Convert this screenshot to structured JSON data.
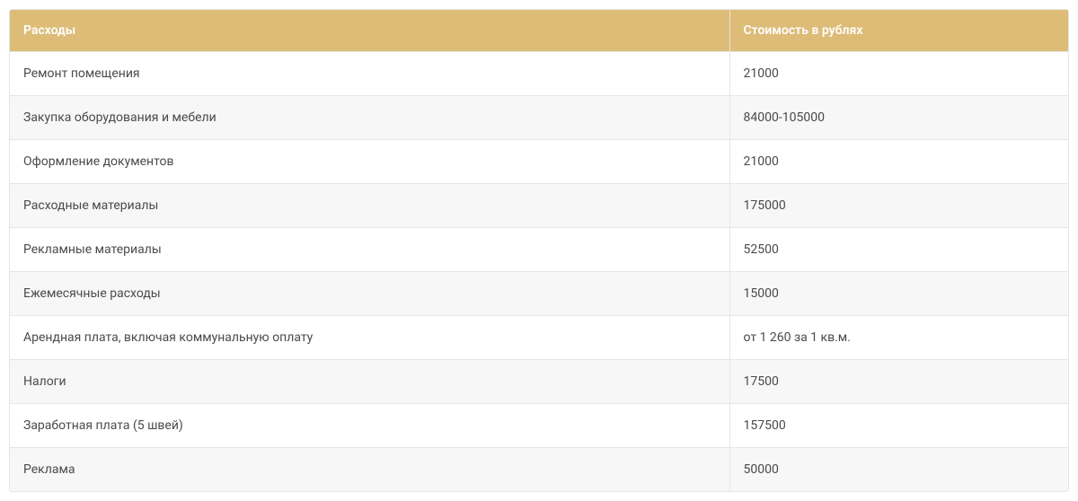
{
  "chart_data": {
    "type": "table",
    "headers": [
      "Расходы",
      "Стоимость в рублях"
    ],
    "rows": [
      [
        "Ремонт помещения",
        "21000"
      ],
      [
        "Закупка оборудования и мебели",
        "84000-105000"
      ],
      [
        "Оформление документов",
        "21000"
      ],
      [
        "Расходные материалы",
        "175000"
      ],
      [
        "Рекламные материалы",
        "52500"
      ],
      [
        "Ежемесячные расходы",
        "15000"
      ],
      [
        "Арендная плата, включая коммунальную оплату",
        "от 1 260 за 1 кв.м."
      ],
      [
        "Налоги",
        "17500"
      ],
      [
        "Заработная плата (5 швей)",
        "157500"
      ],
      [
        "Реклама",
        "50000"
      ]
    ]
  },
  "table": {
    "headers": {
      "expense": "Расходы",
      "cost": "Стоимость в рублях"
    },
    "rows": [
      {
        "expense": "Ремонт помещения",
        "cost": "21000"
      },
      {
        "expense": "Закупка оборудования и мебели",
        "cost": "84000-105000"
      },
      {
        "expense": "Оформление документов",
        "cost": "21000"
      },
      {
        "expense": "Расходные материалы",
        "cost": "175000"
      },
      {
        "expense": "Рекламные материалы",
        "cost": "52500"
      },
      {
        "expense": "Ежемесячные расходы",
        "cost": "15000"
      },
      {
        "expense": "Арендная плата, включая коммунальную оплату",
        "cost": "от 1 260 за 1 кв.м."
      },
      {
        "expense": "Налоги",
        "cost": "17500"
      },
      {
        "expense": "Заработная плата (5 швей)",
        "cost": "157500"
      },
      {
        "expense": "Реклама",
        "cost": "50000"
      }
    ]
  }
}
